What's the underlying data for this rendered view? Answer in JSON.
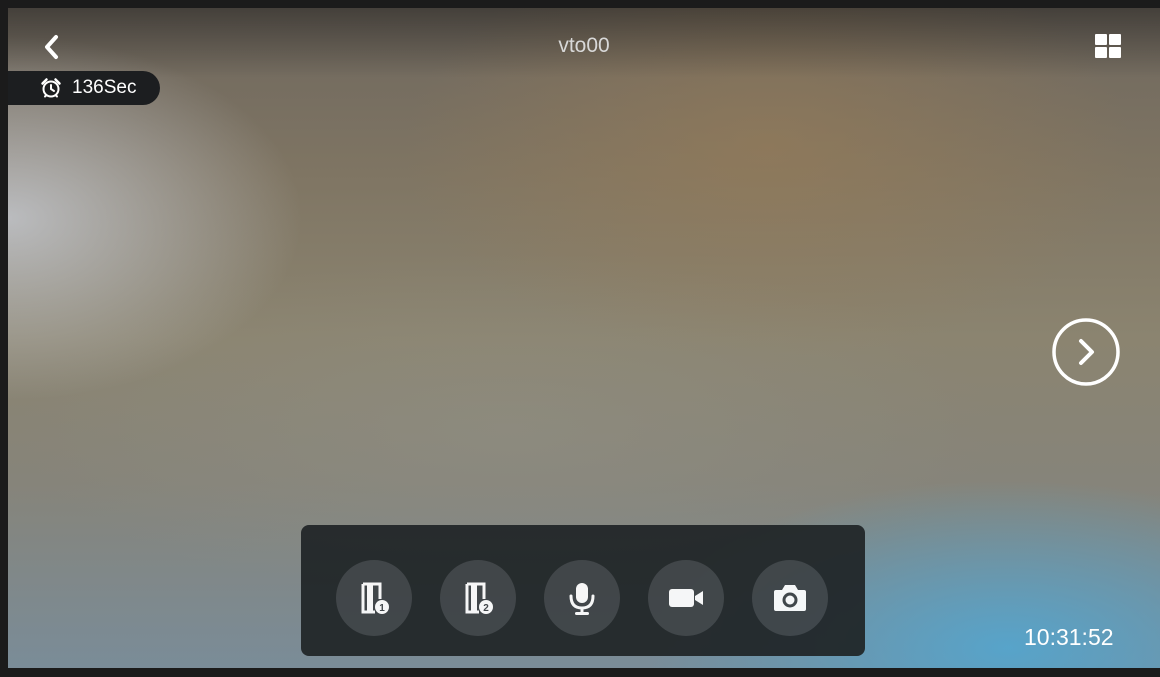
{
  "header": {
    "title": "vto00",
    "back_icon": "chevron-left-icon",
    "layout_icon": "grid-four-icon"
  },
  "timer": {
    "icon": "alarm-clock-icon",
    "value": "136Sec"
  },
  "navigation": {
    "next_icon": "chevron-right-circle-icon"
  },
  "toolbar": {
    "buttons": [
      {
        "name": "unlock-door-1",
        "icon": "door-1-icon"
      },
      {
        "name": "unlock-door-2",
        "icon": "door-2-icon"
      },
      {
        "name": "microphone",
        "icon": "microphone-icon"
      },
      {
        "name": "record-video",
        "icon": "video-camera-icon"
      },
      {
        "name": "snapshot",
        "icon": "camera-icon"
      }
    ]
  },
  "status": {
    "time": "10:31:52"
  },
  "colors": {
    "toolbar_bg": "#202527",
    "button_bg": "#3d4245",
    "icon": "#ffffff"
  }
}
